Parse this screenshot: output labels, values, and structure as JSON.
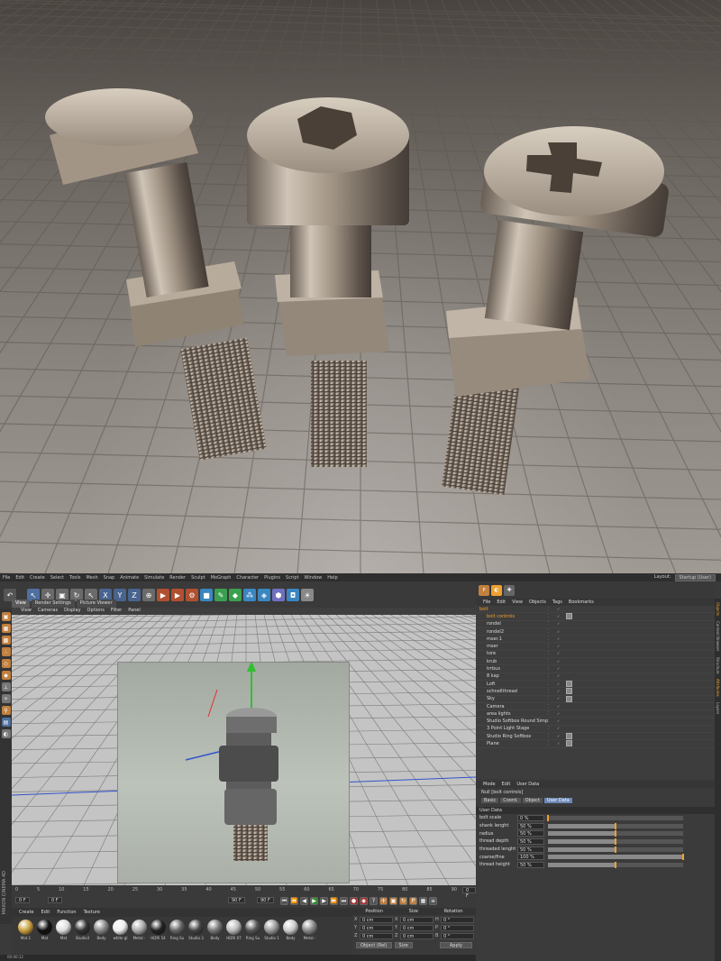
{
  "colors": {
    "accent": "#f0a030",
    "selection": "#6c86b4",
    "tile": "#8c8680"
  },
  "menubar": {
    "items": [
      "File",
      "Edit",
      "Create",
      "Select",
      "Tools",
      "Mesh",
      "Snap",
      "Animate",
      "Simulate",
      "Render",
      "Sculpt",
      "MoGraph",
      "Character",
      "Plugins",
      "Script",
      "Window",
      "Help"
    ],
    "layout_label": "Layout:",
    "layout_value": "Startup (User)"
  },
  "viewport": {
    "tabs": [
      "View",
      "Render Settings",
      "Picture Viewer"
    ],
    "menu": [
      "View",
      "Cameras",
      "Display",
      "Options",
      "Filter",
      "Panel"
    ]
  },
  "timeline": {
    "ticks": [
      "0",
      "5",
      "10",
      "15",
      "20",
      "25",
      "30",
      "35",
      "40",
      "45",
      "50",
      "55",
      "60",
      "65",
      "70",
      "75",
      "80",
      "85",
      "90"
    ],
    "start_field": "0 F",
    "start_field2": "0 F",
    "end_field": "90 F",
    "end_field2": "90 F",
    "current_frame": "0 F",
    "status": "00:00:12"
  },
  "materials": {
    "menu": [
      "Create",
      "Edit",
      "Function",
      "Texture"
    ],
    "items": [
      {
        "label": "Mat.1"
      },
      {
        "label": "Mat"
      },
      {
        "label": "Mat"
      },
      {
        "label": "Studio3"
      },
      {
        "label": "Body"
      },
      {
        "label": "white gl"
      },
      {
        "label": "Metal -"
      },
      {
        "label": "HDRI 54"
      },
      {
        "label": "Ring Su"
      },
      {
        "label": "Studio 3"
      },
      {
        "label": "Body"
      },
      {
        "label": "HDRI 07"
      },
      {
        "label": "Ring Su"
      },
      {
        "label": "Studio 1"
      },
      {
        "label": "Body"
      },
      {
        "label": "Metal -"
      }
    ]
  },
  "coords": {
    "headers": [
      "Position",
      "Size",
      "Rotation"
    ],
    "rows": [
      {
        "a": "X",
        "pos": "0 cm",
        "b": "X",
        "size": "0 cm",
        "c": "H",
        "rot": "0 °"
      },
      {
        "a": "Y",
        "pos": "0 cm",
        "b": "Y",
        "size": "0 cm",
        "c": "P",
        "rot": "0 °"
      },
      {
        "a": "Z",
        "pos": "0 cm",
        "b": "Z",
        "size": "0 cm",
        "c": "B",
        "rot": "0 °"
      }
    ],
    "mode": "Object (Rel)",
    "size_mode": "Size",
    "apply": "Apply"
  },
  "objects": {
    "menu": [
      "File",
      "Edit",
      "View",
      "Objects",
      "Tags",
      "Bookmarks"
    ],
    "rows": [
      {
        "name": "bolt",
        "sel": true
      },
      {
        "name": "bolt controls",
        "sel": true
      },
      {
        "name": "rondel",
        "sel": false
      },
      {
        "name": "rondel2",
        "sel": false
      },
      {
        "name": "mser.1",
        "sel": false
      },
      {
        "name": "mser",
        "sel": false
      },
      {
        "name": "tore",
        "sel": false
      },
      {
        "name": "krub",
        "sel": false
      },
      {
        "name": "trrbus",
        "sel": false
      },
      {
        "name": "8 kap",
        "sel": false
      },
      {
        "name": "Loft",
        "sel": false
      },
      {
        "name": "schnellthread",
        "sel": false
      },
      {
        "name": "Sky",
        "sel": false
      },
      {
        "name": "Camera",
        "sel": false
      },
      {
        "name": "area lights",
        "sel": false
      },
      {
        "name": "Studio Softbox Round Simple",
        "sel": false
      },
      {
        "name": "3 Point Light Stage",
        "sel": false
      },
      {
        "name": "Studio Ring Softbox",
        "sel": false
      },
      {
        "name": "Plane",
        "sel": false
      }
    ]
  },
  "attributes": {
    "menu": [
      "Mode",
      "Edit",
      "User Data"
    ],
    "title": "Null [bolt controls]",
    "tabs": [
      "Basic",
      "Coord.",
      "Object",
      "User Data"
    ],
    "active_tab": "User Data",
    "section": "User Data",
    "params": [
      {
        "label": "bolt scale",
        "value": "0 %",
        "level": 0.0
      },
      {
        "label": "shank lenght",
        "value": "50 %",
        "level": 0.5
      },
      {
        "label": "radius",
        "value": "50 %",
        "level": 0.5
      },
      {
        "label": "thread depth",
        "value": "50 %",
        "level": 0.5
      },
      {
        "label": "threaded lenght",
        "value": "50 %",
        "level": 0.5
      },
      {
        "label": "coarse/fine",
        "value": "100 %",
        "level": 1.0
      },
      {
        "label": "thread height",
        "value": "50 %",
        "level": 0.5
      }
    ]
  },
  "sidetabs": [
    "Objects",
    "Content Browser",
    "Structure",
    "Attributes",
    "Layers"
  ],
  "brand": "MAXON CINEMA 4D"
}
